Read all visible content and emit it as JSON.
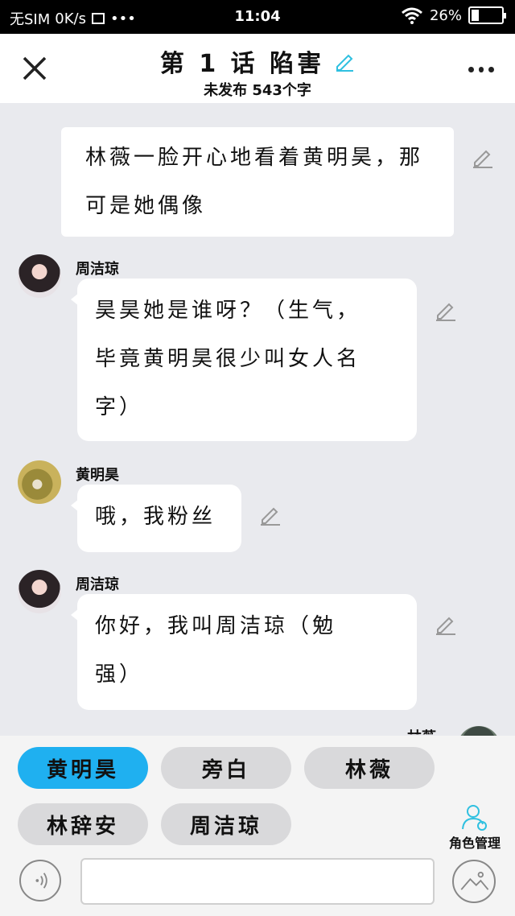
{
  "status_bar": {
    "carrier": "无SIM",
    "speed": "0K/s",
    "time": "11:04",
    "battery": "26%",
    "battery_level": 0.26
  },
  "header": {
    "title": "第 1 话 陷害",
    "subtitle": "未发布 543个字"
  },
  "messages": [
    {
      "type": "narration",
      "text_line1": "林薇一脸开心地看着黄明昊，那",
      "text_line2": "可是她偶像"
    },
    {
      "type": "dialogue",
      "speaker": "周洁琼",
      "avatar": "avatar-zhou",
      "line1": "昊昊她是谁呀？（生气，",
      "line2": "毕竟黄明昊很少叫女人名",
      "line3": "字）"
    },
    {
      "type": "dialogue",
      "speaker": "黄明昊",
      "avatar": "avatar-huang",
      "line1": "哦，我粉丝"
    },
    {
      "type": "dialogue",
      "speaker": "周洁琼",
      "avatar": "avatar-zhou",
      "line1": "你好，我叫周洁琼（勉",
      "line2": "强）"
    },
    {
      "type": "dialogue",
      "speaker": "林薇",
      "avatar": "avatar-lin"
    }
  ],
  "roles": {
    "chips": [
      "黄明昊",
      "旁白",
      "林薇",
      "林辞安",
      "周洁琼"
    ],
    "active": "黄明昊",
    "manage_label": "角色管理"
  },
  "input": {
    "value": ""
  },
  "colors": {
    "accent": "#1fb0f0",
    "edit_icon": "#2fc0e0"
  },
  "icons": [
    "close-icon",
    "more-icon",
    "edit-title-icon",
    "edit-icon",
    "voice-icon",
    "image-icon",
    "role-manage-icon",
    "wifi-icon",
    "battery-icon"
  ]
}
